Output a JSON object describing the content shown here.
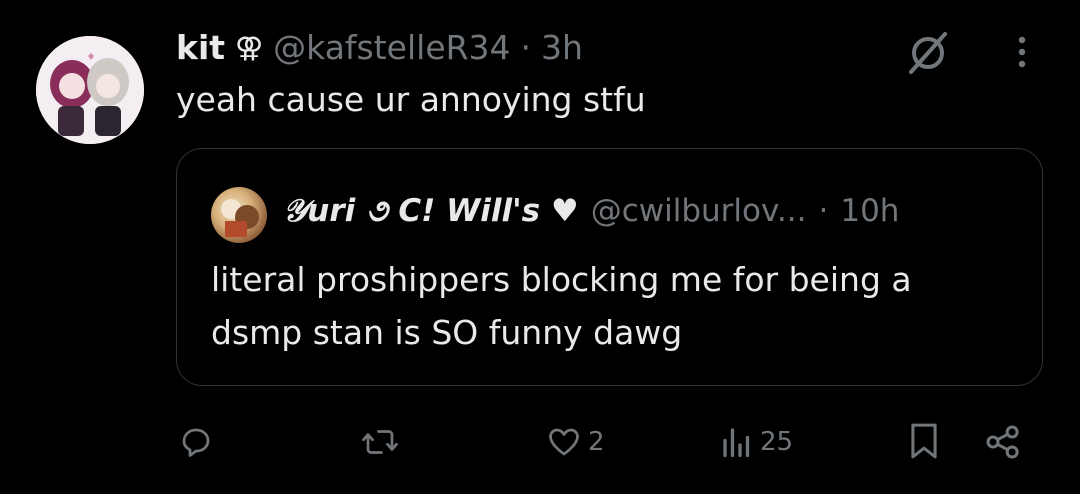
{
  "tweet": {
    "author_name": "kit",
    "author_symbol": "⚢",
    "author_handle": "@kafstelleR34",
    "separator": "·",
    "time": "3h",
    "text": "yeah cause ur annoying stfu"
  },
  "quoted_tweet": {
    "author_name": "𝒴uri ૭ C! Will's ♥",
    "author_handle": "@cwilburlov...",
    "separator": "·",
    "time": "10h",
    "text": "literal proshippers blocking me for being a dsmp stan is SO funny dawg"
  },
  "actions": {
    "reply_count": "",
    "retweet_count": "",
    "like_count": "2",
    "views_count": "25"
  },
  "icons": {
    "grok": "grok-icon",
    "more": "more-icon",
    "reply": "reply-icon",
    "retweet": "retweet-icon",
    "like": "heart-icon",
    "views": "analytics-icon",
    "bookmark": "bookmark-icon",
    "share": "share-icon"
  },
  "colors": {
    "background": "#000000",
    "text": "#e7e9ea",
    "secondary": "#71767b",
    "border": "#2f3336"
  }
}
